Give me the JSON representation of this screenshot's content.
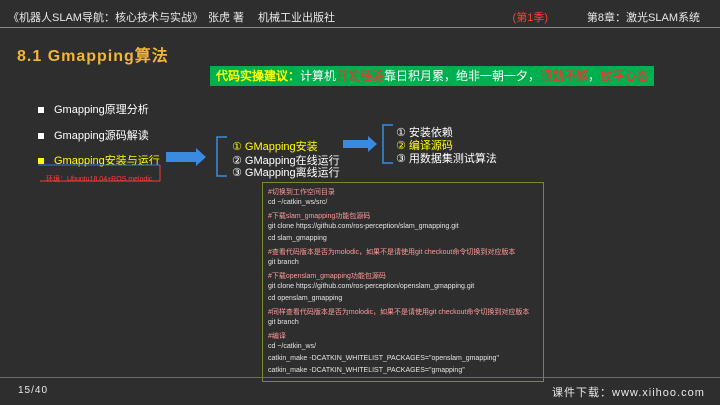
{
  "header": {
    "book": "《机器人SLAM导航：核心技术与实战》",
    "author": "张虎 著",
    "publisher": "机械工业出版社",
    "edition": "(第1季)",
    "chapter": "第8章：激光SLAM系统"
  },
  "slide": {
    "title": "8.1 Gmapping算法",
    "advice": {
      "label": "代码实操建议：",
      "p1": "计算机",
      "r1": "开发经验",
      "p2": "靠日积月累，绝非一朝一夕，",
      "r2": "须勤不懈",
      "p3": "，",
      "r3": "放平心态"
    },
    "bullets": [
      "Gmapping原理分析",
      "Gmapping源码解读",
      "Gmapping安装与运行"
    ],
    "note": "环境：Ubuntu18.04+ROS melodic",
    "steps": [
      "①  GMapping安装",
      "②  GMapping在线运行",
      "③  GMapping离线运行"
    ],
    "substeps": [
      "①  安装依赖",
      "②  编译源码",
      "③  用数据集测试算法"
    ],
    "code_lines": [
      "#切换到工作空间目录",
      "cd ~/catkin_ws/src/",
      "#下载slam_gmapping功能包源码",
      "git clone https://github.com/ros-perception/slam_gmapping.git",
      "cd slam_gmapping",
      "#查看代码版本是否为molodic，如果不是请使用git checkout命令切换到对应版本",
      "git branch",
      "#下载openslam_gmapping功能包源码",
      "git clone https://github.com/ros-perception/openslam_gmapping.git",
      "cd  openslam_gmapping",
      "#同样查看代码版本是否为molodic，如果不是请使用git checkout命令切换到对应版本",
      "git branch",
      "#编译",
      "cd ~/catkin_ws/",
      "catkin_make -DCATKIN_WHITELIST_PACKAGES=\"openslam_gmapping\"",
      "catkin_make -DCATKIN_WHITELIST_PACKAGES=\"gmapping\""
    ]
  },
  "footer": {
    "page": "15/40",
    "download": "课件下载：www.xiihoo.com"
  }
}
